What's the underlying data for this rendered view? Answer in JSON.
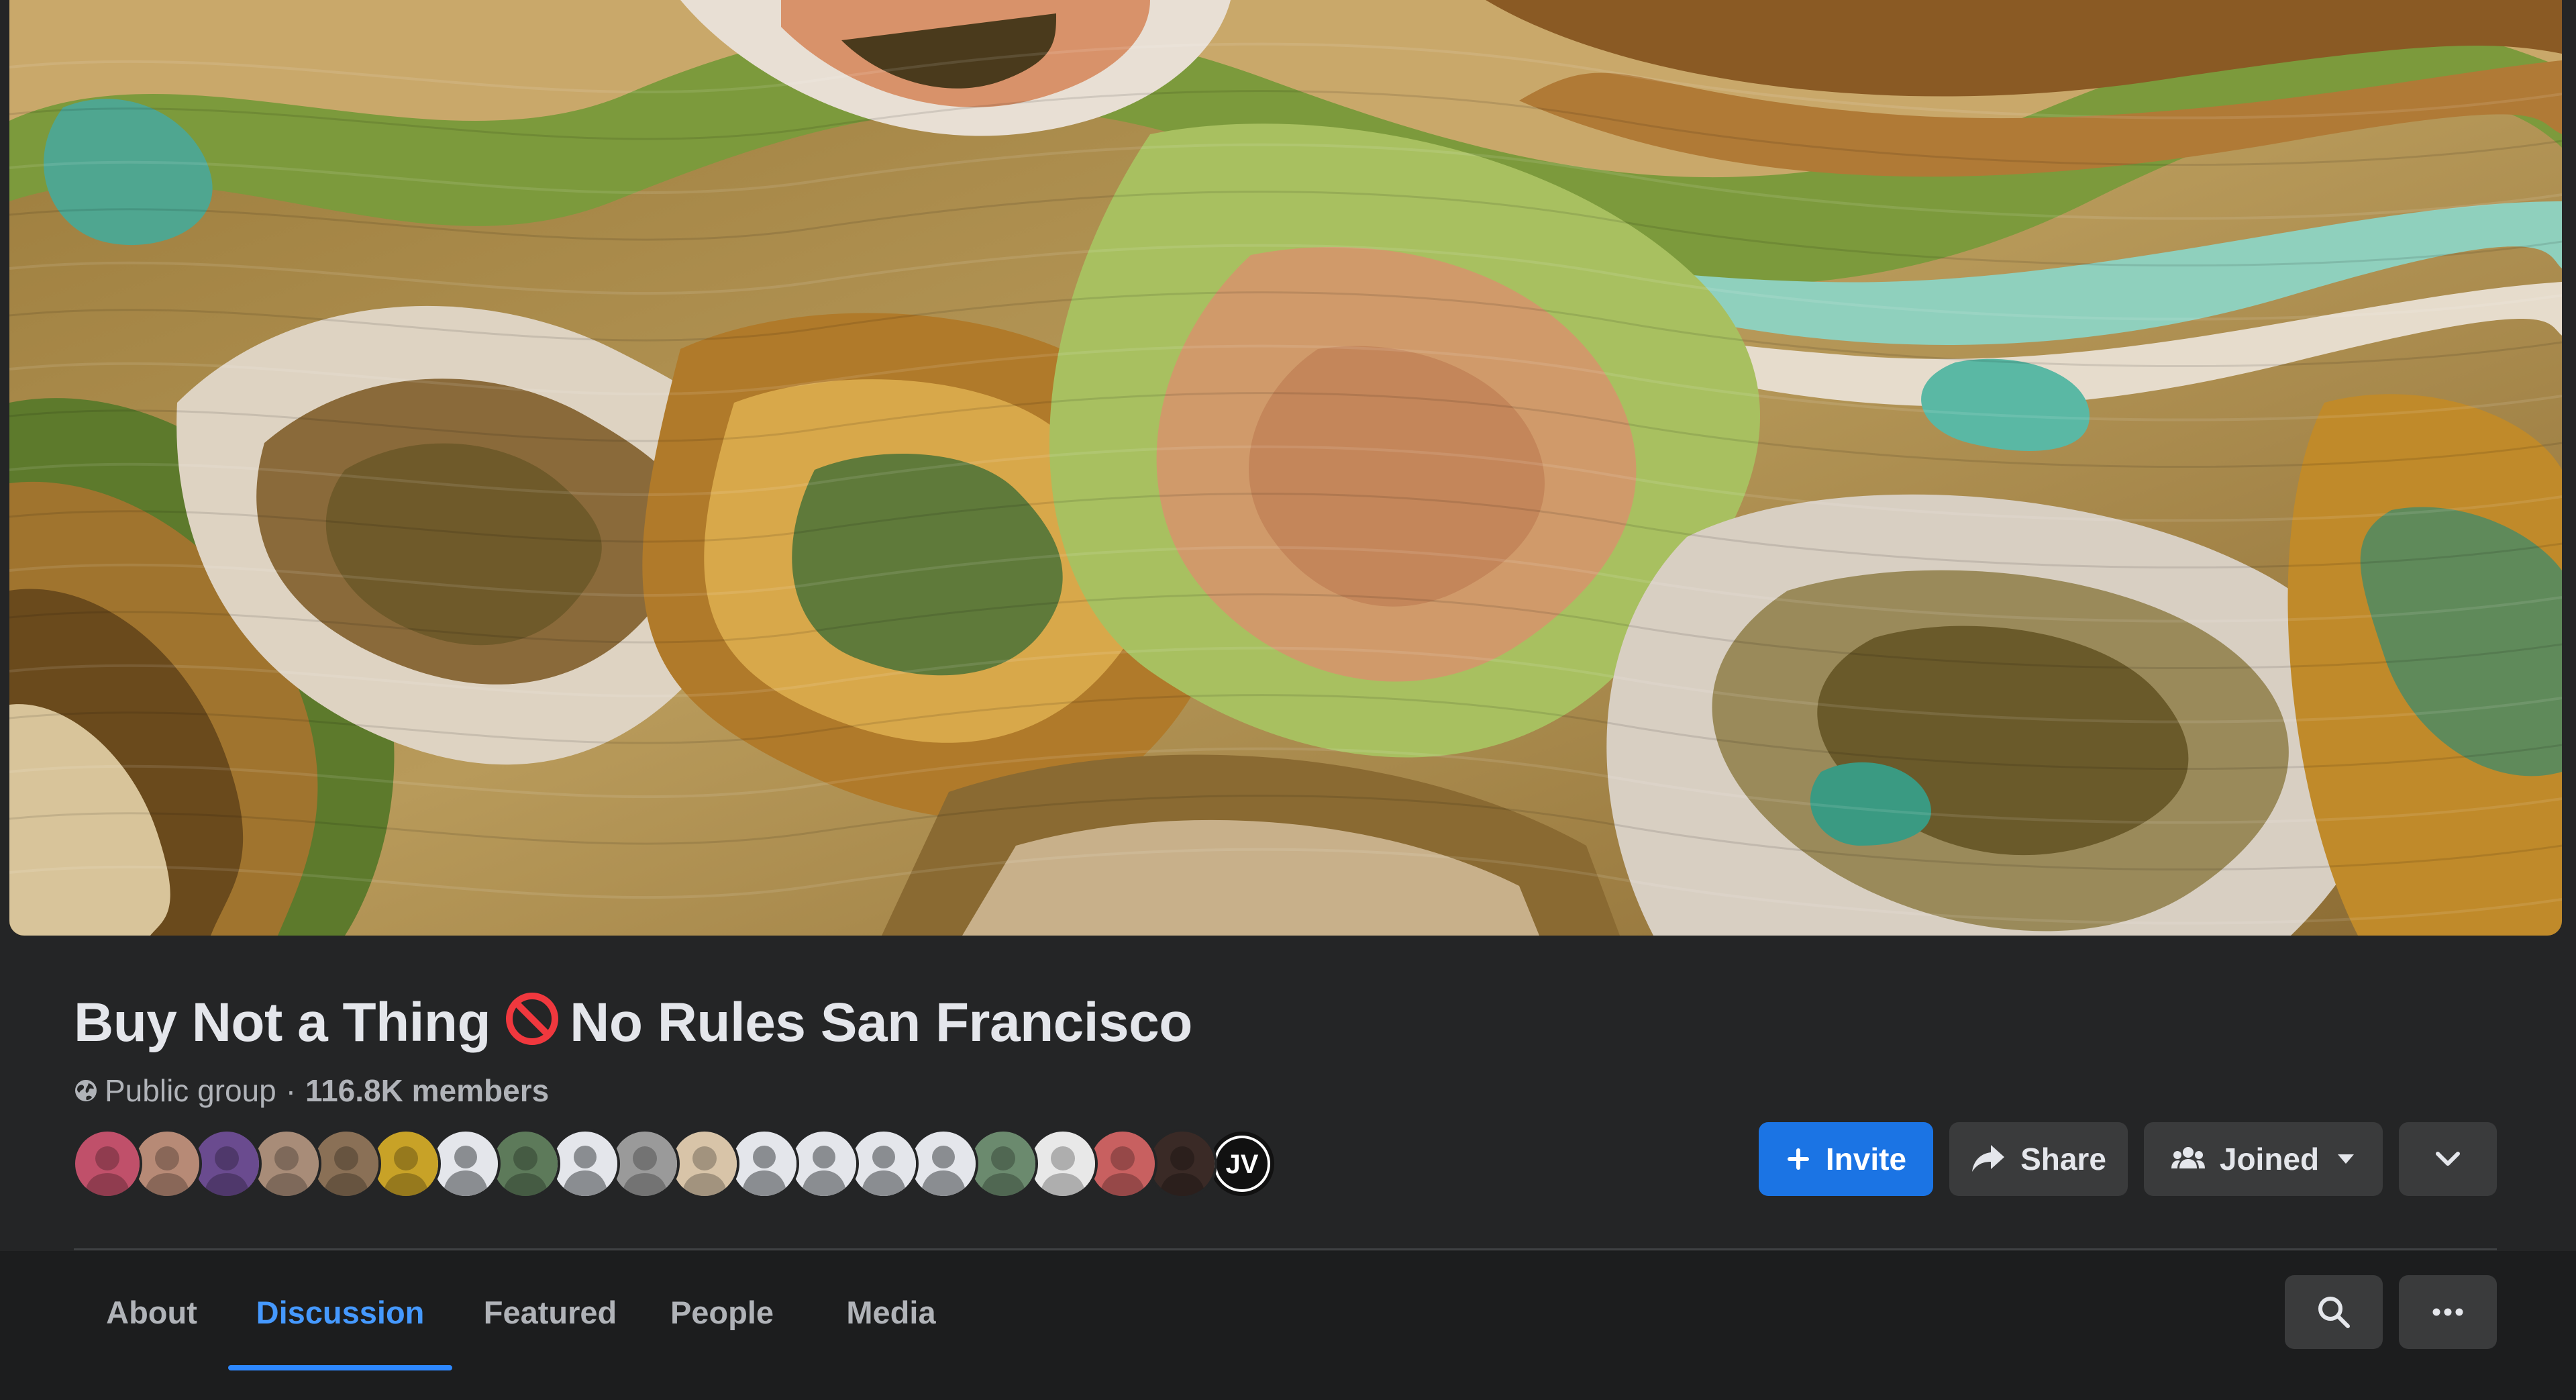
{
  "group": {
    "title_part1": "Buy Not a Thing",
    "title_part2": "No Rules San Francisco",
    "title_icon": "prohibited-icon",
    "privacy": "Public group",
    "separator": "·",
    "members": "116.8K members"
  },
  "actions": {
    "invite_label": "Invite",
    "share_label": "Share",
    "joined_label": "Joined"
  },
  "tabs": [
    {
      "label": "About"
    },
    {
      "label": "Discussion",
      "active": true
    },
    {
      "label": "Featured"
    },
    {
      "label": "People"
    },
    {
      "label": "Media"
    }
  ],
  "avatars": [
    {
      "name": "member-avatar-1",
      "color": "#c0506a"
    },
    {
      "name": "member-avatar-2",
      "color": "#b78a76"
    },
    {
      "name": "member-avatar-3",
      "color": "#6a4b8f"
    },
    {
      "name": "member-avatar-4",
      "color": "#a88c78"
    },
    {
      "name": "member-avatar-5",
      "color": "#8a7056"
    },
    {
      "name": "member-avatar-6",
      "color": "#c8a227"
    },
    {
      "name": "member-avatar-7",
      "color": "default"
    },
    {
      "name": "member-avatar-8",
      "color": "#5d7a5a"
    },
    {
      "name": "member-avatar-9",
      "color": "default"
    },
    {
      "name": "member-avatar-10",
      "color": "#9a9a9a"
    },
    {
      "name": "member-avatar-11",
      "color": "#d8c4a8"
    },
    {
      "name": "member-avatar-12",
      "color": "default"
    },
    {
      "name": "member-avatar-13",
      "color": "default"
    },
    {
      "name": "member-avatar-14",
      "color": "default"
    },
    {
      "name": "member-avatar-15",
      "color": "default"
    },
    {
      "name": "member-avatar-16",
      "color": "#6b8a6e"
    },
    {
      "name": "member-avatar-17",
      "color": "#e8e8e8"
    },
    {
      "name": "member-avatar-18",
      "color": "#c86060"
    },
    {
      "name": "member-avatar-19",
      "color": "#3a2a26"
    },
    {
      "name": "member-avatar-20",
      "color": "#111111",
      "text": "JV"
    }
  ],
  "colors": {
    "background": "#242526",
    "accent_blue": "#1b74e4",
    "active_tab": "#4599ff",
    "button_gray": "#3a3b3c"
  }
}
